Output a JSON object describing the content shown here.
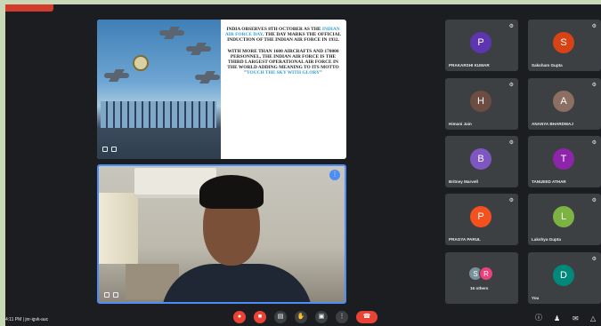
{
  "meeting": {
    "time": "4:11 PM",
    "separator": "|",
    "code": "jnr-igvk-auc"
  },
  "slide": {
    "paragraph1_before": "INDIA OBSERVES 8TH OCTOBER AS THE ",
    "paragraph1_highlight": "INDIAN AIR FORCE DAY",
    "paragraph1_after": ". THE DAY MARKS THE OFFICIAL INDUCTION OF THE INDIAN AIR FORCE IN 1932.",
    "paragraph2_before": "WITH MORE THAN 1600 AIRCRAFTS AND 170000 PERSONNEL, THE INDIAN AIR FORCE IS THE THIRD LARGEST OPERATIONAL AIR FORCE IN THE WORLD ADDING MEANING TO ITS MOTTO \"",
    "paragraph2_highlight": "TOUCH THE SKY WITH GLORY",
    "paragraph2_after": "\"",
    "highlight_color": "#2a9fd6"
  },
  "participants": [
    {
      "initial": "P",
      "name": "PRAKARSHI KUMAR",
      "color": "#5e35b1"
    },
    {
      "initial": "S",
      "name": "Saksham Gupta",
      "color": "#d84315"
    },
    {
      "initial": "H",
      "name": "Himani Jain",
      "color": "#6d4c41"
    },
    {
      "initial": "A",
      "name": "ANANYA BHARDWAJ",
      "color": "#8d6e63"
    },
    {
      "initial": "B",
      "name": "Britney Marvell",
      "color": "#7e57c2"
    },
    {
      "initial": "T",
      "name": "TANUEED ATHAR",
      "color": "#8e24aa"
    },
    {
      "initial": "P",
      "name": "PRAGYA PARUL",
      "color": "#f4511e"
    },
    {
      "initial": "L",
      "name": "Lakshya Gupta",
      "color": "#7cb342"
    },
    {
      "initial": "D",
      "name": "You",
      "color": "#00897b"
    }
  ],
  "others": {
    "label": "16 others",
    "avatars": [
      {
        "initial": "S",
        "color": "#78909c"
      },
      {
        "initial": "R",
        "color": "#ec407a"
      }
    ]
  },
  "controls": {
    "leave_color": "#ea4335",
    "mic_color": "#ea4335",
    "cam_color": "#ea4335",
    "neutral_color": "#3c4043"
  }
}
